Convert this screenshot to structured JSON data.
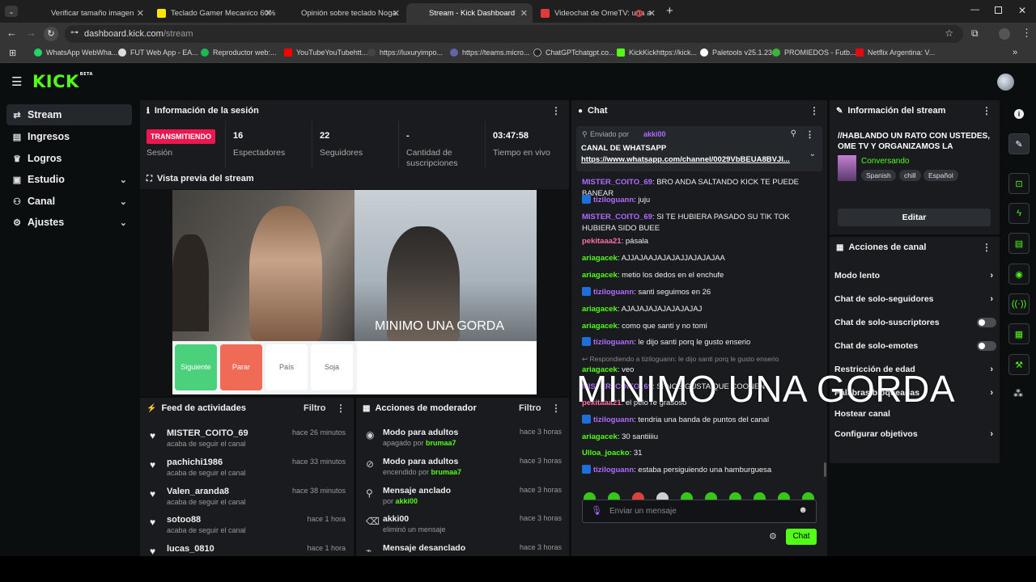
{
  "browser": {
    "tabs": [
      {
        "label": "Verificar tamaño imagen",
        "active": false
      },
      {
        "label": "Teclado Gamer Mecanico 60% | ",
        "active": false
      },
      {
        "label": "Opinión sobre teclado Noga",
        "active": false
      },
      {
        "label": "Stream - Kick Dashboard",
        "active": true
      },
      {
        "label": "Videochat de OmeTV: una a",
        "active": false
      }
    ],
    "new_tab": "+",
    "url_host": "dashboard.kick.com",
    "url_path": "/stream",
    "bookmarks": [
      "WhatsApp WebWha...",
      "FUT Web App - EA...",
      "Reproductor web:...",
      "YouTubeYouTubehtt...",
      "https://luxuryimpo...",
      "https://teams.micro...",
      "ChatGPTchatgpt.co...",
      "KickKickhttps://kick...",
      "Paletools v25.1.23",
      "PROMIEDOS - Futb...",
      "Netflix Argentina: V..."
    ]
  },
  "app": {
    "logo": "KICK",
    "logo_sup": "BETA"
  },
  "sidebar": [
    {
      "label": "Stream",
      "icon": "⇄",
      "active": true,
      "chevron": false
    },
    {
      "label": "Ingresos",
      "icon": "▤",
      "chevron": false
    },
    {
      "label": "Logros",
      "icon": "♛",
      "chevron": false
    },
    {
      "label": "Estudio",
      "icon": "▣",
      "chevron": true
    },
    {
      "label": "Canal",
      "icon": "⚇",
      "chevron": true
    },
    {
      "label": "Ajustes",
      "icon": "⚙",
      "chevron": true
    }
  ],
  "session": {
    "title": "Información de la sesión",
    "live_badge": "TRANSMITIENDO",
    "live_label": "Sesión",
    "stats": [
      {
        "value": "16",
        "label": "Espectadores"
      },
      {
        "value": "22",
        "label": "Seguidores"
      },
      {
        "value": "-",
        "label": "Cantidad de suscripciones"
      },
      {
        "value": "03:47:58",
        "label": "Tiempo en vivo"
      }
    ]
  },
  "preview": {
    "title": "Vista previa del stream",
    "overlay_text": "MINIMO UNA GORDA",
    "buttons": [
      "Siguiente",
      "Parar",
      "País",
      "Soja"
    ]
  },
  "feed": {
    "title": "Feed de actividades",
    "filter": "Filtro",
    "items": [
      {
        "name": "MISTER_COITO_69",
        "desc": "acaba de seguir el canal",
        "time": "hace 26 minutos"
      },
      {
        "name": "pachichi1986",
        "desc": "acaba de seguir el canal",
        "time": "hace 33 minutos"
      },
      {
        "name": "Valen_aranda8",
        "desc": "acaba de seguir el canal",
        "time": "hace 38 minutos"
      },
      {
        "name": "sotoo88",
        "desc": "acaba de seguir el canal",
        "time": "hace 1 hora"
      },
      {
        "name": "lucas_0810",
        "desc": "",
        "time": "hace 1 hora"
      }
    ]
  },
  "modactions": {
    "title": "Acciones de moderador",
    "filter": "Filtro",
    "items": [
      {
        "title": "Modo para adultos",
        "pre": "apagado por ",
        "user": "brumaa7",
        "time": "hace 3 horas",
        "icon": "👁"
      },
      {
        "title": "Modo para adultos",
        "pre": "encendido por ",
        "user": "brumaa7",
        "time": "hace 3 horas",
        "icon": "⊘"
      },
      {
        "title": "Mensaje anclado",
        "pre": "por ",
        "user": "akki00",
        "time": "hace 3 horas",
        "icon": "📌"
      },
      {
        "title": "akki00",
        "pre": "eliminó un mensaje",
        "user": "",
        "time": "hace 3 horas",
        "icon": "🗑"
      },
      {
        "title": "Mensaje desanclado",
        "pre": "",
        "user": "",
        "time": "hace 3 horas",
        "icon": "⌁"
      }
    ]
  },
  "chat": {
    "title": "Chat",
    "pinned_by_label": "Enviado por",
    "pinned_user": "akki00",
    "pinned_title": "CANAL DE WHATSAPP",
    "pinned_link": "https://www.whatsapp.com/channel/0029VbBEUA8BVJI...",
    "messages": [
      {
        "user": "MISTER_COITO_69",
        "color": "#b26bff",
        "text": ": BRO ANDA SALTANDO KICK TE PUEDE BANEAR",
        "badge": false
      },
      {
        "user": "tiziloguann",
        "color": "#b26bff",
        "text": ": juju",
        "badge": true
      },
      {
        "user": "MISTER_COITO_69",
        "color": "#b26bff",
        "text": ": SI TE HUBIERA PASADO SU TIK TOK HUBIERA SIDO BUEE",
        "badge": false
      },
      {
        "user": "pekitaaa21",
        "color": "#ff6fa8",
        "text": ": pásala",
        "badge": false
      },
      {
        "user": "ariagacek",
        "color": "#53fc18",
        "text": ": AJJAJAAJAJAJAJJAJAJAJAA",
        "badge": false
      },
      {
        "user": "ariagacek",
        "color": "#53fc18",
        "text": ": metio los dedos en el enchufe",
        "badge": false
      },
      {
        "user": "tiziloguann",
        "color": "#b26bff",
        "text": ": santi seguimos en 26",
        "badge": true
      },
      {
        "user": "ariagacek",
        "color": "#53fc18",
        "text": ": AJAJAJAJAJAJAJAJAJ",
        "badge": false
      },
      {
        "user": "ariagacek",
        "color": "#53fc18",
        "text": ": como que santi y no tomi",
        "badge": false
      },
      {
        "user": "tiziloguann",
        "color": "#b26bff",
        "text": ": le dijo santi porq le gusto enserio",
        "badge": true
      }
    ],
    "reply_to": "Respondiendo a tiziloguann: le dijo santi porq le gusto enserio",
    "messages2": [
      {
        "user": "ariagacek",
        "color": "#53fc18",
        "text": ": veo",
        "badge": false
      },
      {
        "user": "MISTER_COITO_69",
        "color": "#b26bff",
        "text": ": SI NOS GUSTA QUE COONEN",
        "badge": false
      },
      {
        "user": "pekitaaa21",
        "color": "#ff6fa8",
        "text": ": el pelo re grasoso",
        "badge": false
      },
      {
        "user": "tiziloguann",
        "color": "#b26bff",
        "text": ": tendria una banda de puntos del canal",
        "badge": true
      },
      {
        "user": "ariagacek",
        "color": "#53fc18",
        "text": ": 30 santiiiiu",
        "badge": false
      },
      {
        "user": "Ulloa_joacko",
        "color": "#53fc18",
        "text": ": 31",
        "badge": false
      },
      {
        "user": "tiziloguann",
        "color": "#b26bff",
        "text": ": estaba persiguiendo una hamburguesa",
        "badge": true
      }
    ],
    "input_placeholder": "Enviar un mensaje",
    "send_label": "Chat"
  },
  "streaminfo": {
    "title": "Información del stream",
    "stream_title": "//HABLANDO UN RATO CON USTEDES, OME TV Y ORGANIZAMOS LA SEMANA...",
    "category": "Conversando",
    "tags": [
      "Spanish",
      "chill",
      "Español"
    ],
    "edit_label": "Editar"
  },
  "channelactions": {
    "title": "Acciones de canal",
    "items": [
      {
        "label": "Modo lento",
        "kind": "chevron"
      },
      {
        "label": "Chat de solo-seguidores",
        "kind": "chevron"
      },
      {
        "label": "Chat de solo-suscriptores",
        "kind": "toggle",
        "on": false
      },
      {
        "label": "Chat de solo-emotes",
        "kind": "toggle",
        "on": false
      },
      {
        "label": "Restricción de edad",
        "kind": "chevron"
      },
      {
        "label": "Palabras bloqueadas",
        "kind": "chevron"
      },
      {
        "label": "Hostear canal",
        "kind": "none"
      },
      {
        "label": "Configurar objetivos",
        "kind": "chevron"
      }
    ]
  },
  "colors": {
    "brand": "#53fc18",
    "live": "#e91950",
    "panel": "#191b1f"
  }
}
